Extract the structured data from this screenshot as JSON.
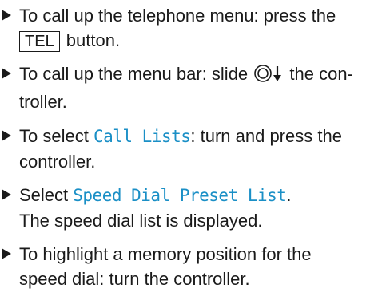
{
  "steps": [
    {
      "pre": "To call up the telephone menu: press the",
      "key": "TEL",
      "post": " button."
    },
    {
      "pre": "To call up the menu bar: slide ",
      "icon": "controller-slide-down-icon",
      "post": " the con-",
      "line2": "troller."
    },
    {
      "pre": "To select ",
      "term": "Call Lists",
      "post": ": turn and press the",
      "line2": "controller."
    },
    {
      "pre": "Select ",
      "term": "Speed Dial Preset List",
      "post": ".",
      "line2": "The speed dial list is displayed."
    },
    {
      "line1": "To highlight a memory position for the",
      "line2": "speed dial: turn the controller."
    }
  ]
}
